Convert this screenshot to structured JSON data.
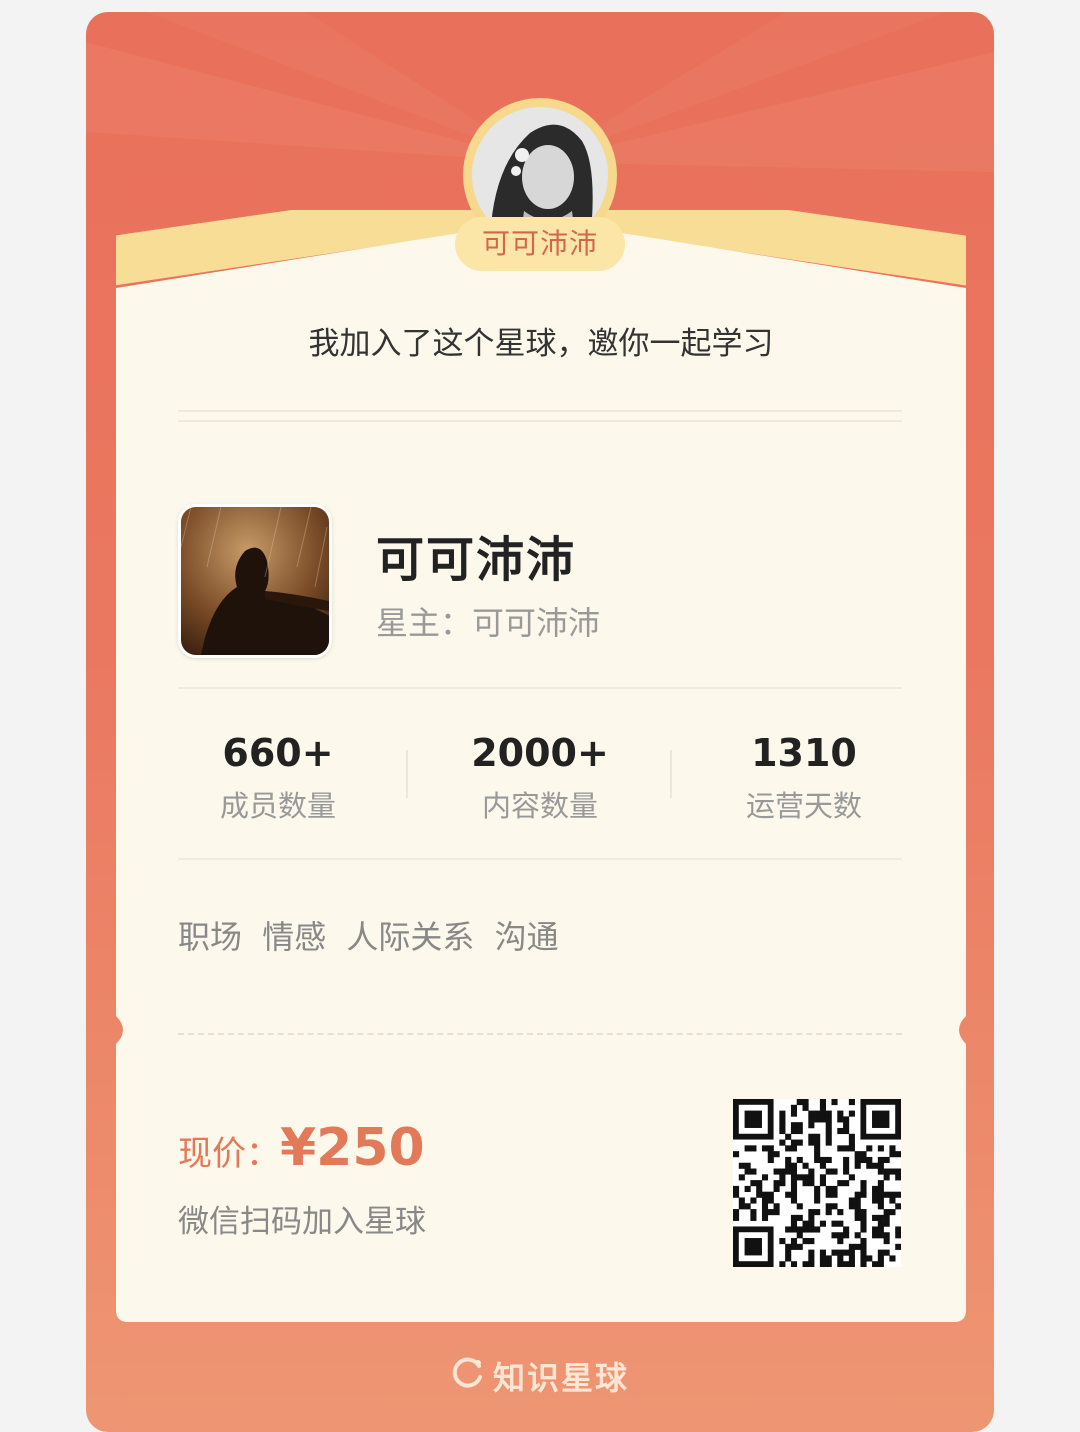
{
  "card": {
    "owner_name": "可可沛沛",
    "invite_text": "我加入了这个星球，邀你一起学习"
  },
  "group": {
    "name": "可可沛沛",
    "owner_label": "星主：",
    "owner_name": "可可沛沛"
  },
  "stats": [
    {
      "value": "660+",
      "label": "成员数量"
    },
    {
      "value": "2000+",
      "label": "内容数量"
    },
    {
      "value": "1310",
      "label": "运营天数"
    }
  ],
  "tags": [
    "职场",
    "情感",
    "人际关系",
    "沟通"
  ],
  "price": {
    "label": "现价：",
    "value": "¥250"
  },
  "scan_text": "微信扫码加入星球",
  "footer": {
    "brand": "知识星球"
  },
  "colors": {
    "card_top": "#e9705a",
    "card_bottom": "#ee9673",
    "paper": "#fcf8ec",
    "gold": "#f6d98d",
    "price": "#e27a5a"
  }
}
